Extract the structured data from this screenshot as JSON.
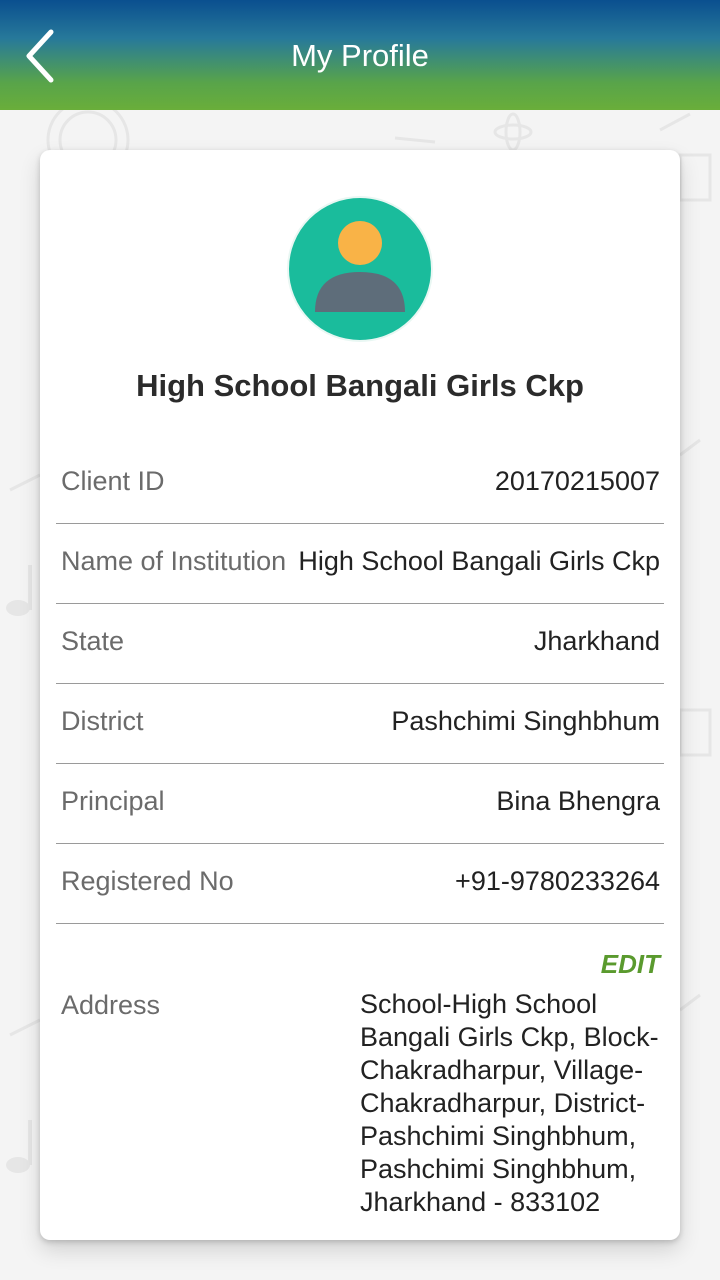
{
  "header": {
    "title": "My Profile"
  },
  "profile": {
    "name": "High School Bangali Girls Ckp",
    "fields": [
      {
        "label": "Client ID",
        "value": "20170215007"
      },
      {
        "label": "Name of Institution",
        "value": "High School Bangali Girls Ckp"
      },
      {
        "label": "State",
        "value": "Jharkhand"
      },
      {
        "label": "District",
        "value": "Pashchimi Singhbhum"
      },
      {
        "label": "Principal",
        "value": "Bina Bhengra"
      },
      {
        "label": "Registered No",
        "value": "+91-9780233264"
      }
    ],
    "edit_label": "EDIT",
    "address_label": "Address",
    "address_value": "School-High School Bangali Girls Ckp, Block-Chakradharpur, Village-Chakradharpur, District-Pashchimi Singhbhum, Pashchimi Singhbhum, Jharkhand - 833102"
  },
  "colors": {
    "header_top": "#0a4f8f",
    "header_bottom": "#6aae3a",
    "avatar_bg": "#1abc9c",
    "avatar_head": "#f9b347",
    "avatar_body": "#5e6d7a",
    "edit": "#5a9a2e"
  }
}
